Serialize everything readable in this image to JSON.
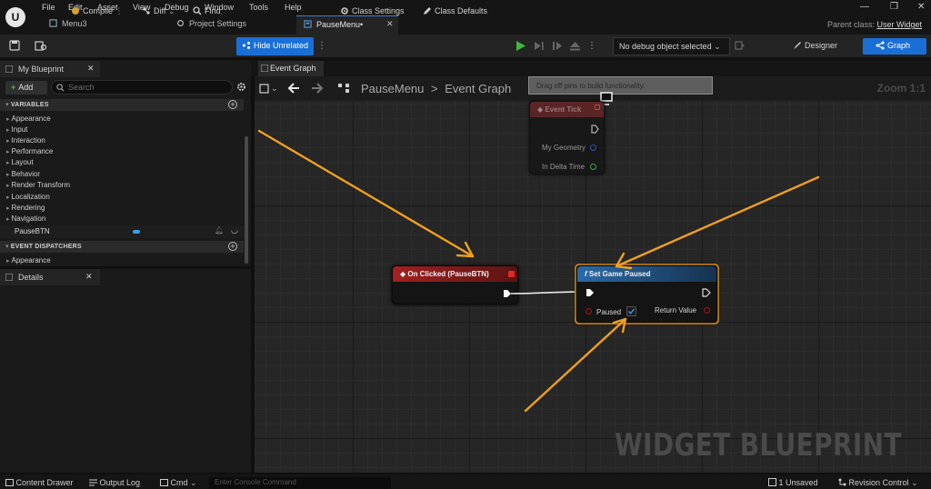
{
  "menu": {
    "items": [
      "File",
      "Edit",
      "Asset",
      "View",
      "Debug",
      "Window",
      "Tools",
      "Help"
    ]
  },
  "tabs": [
    {
      "label": "Menu3"
    },
    {
      "label": "Project Settings"
    },
    {
      "label": "PauseMenu•"
    }
  ],
  "parent_class": {
    "label": "Parent class:",
    "value": "User Widget"
  },
  "toolbar": {
    "compile": "Compile",
    "diff": "Diff",
    "find": "Find",
    "hide_unrelated": "Hide Unrelated",
    "class_settings": "Class Settings",
    "class_defaults": "Class Defaults",
    "debug_object": "No debug object selected",
    "designer": "Designer",
    "graph": "Graph"
  },
  "left_panel": {
    "tab": "My Blueprint",
    "add": "Add",
    "search_placeholder": "Search",
    "variables_header": "VARIABLES",
    "categories": [
      "Appearance",
      "Input",
      "Interaction",
      "Performance",
      "Layout",
      "Behavior",
      "Render Transform",
      "Localization",
      "Rendering",
      "Navigation"
    ],
    "variable": "PauseBTN",
    "dispatchers_header": "EVENT DISPATCHERS",
    "dispatcher_category": "Appearance",
    "details_tab": "Details"
  },
  "graph": {
    "tab": "Event Graph",
    "breadcrumb_root": "PauseMenu",
    "breadcrumb_sep": ">",
    "breadcrumb_leaf": "Event Graph",
    "zoom": "Zoom 1:1",
    "tooltip": "Drag off pins to build functionality.",
    "watermark": "WIDGET BLUEPRINT",
    "nodes": {
      "event_tick": {
        "title": "Event Tick",
        "pins": [
          "My Geometry",
          "In Delta Time"
        ]
      },
      "on_clicked": {
        "title": "On Clicked (PauseBTN)"
      },
      "set_game_paused": {
        "title": "Set Game Paused",
        "input": "Paused",
        "output": "Return Value",
        "paused_checked": true
      }
    }
  },
  "statusbar": {
    "content_drawer": "Content Drawer",
    "output_log": "Output Log",
    "cmd": "Cmd",
    "console_placeholder": "Enter Console Command",
    "unsaved": "1 Unsaved",
    "revision": "Revision Control"
  },
  "colors": {
    "accent": "#1a6fd6",
    "event_header": "#8b1a1a",
    "function_header": "#1e4f7a",
    "annotation_arrow": "#f0a020",
    "selection": "#f0a020"
  }
}
